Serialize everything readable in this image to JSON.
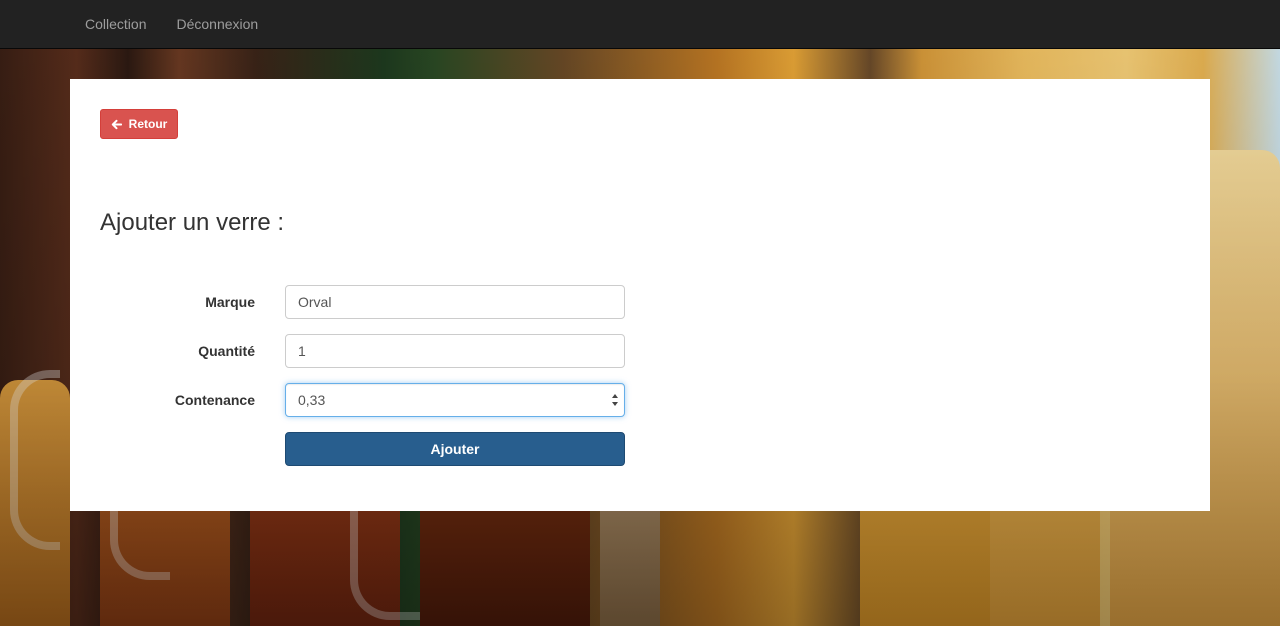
{
  "navbar": {
    "links": [
      "Collection",
      "Déconnexion"
    ]
  },
  "back_button": {
    "label": "Retour",
    "icon": "arrow-left-icon"
  },
  "page_title": "Ajouter un verre :",
  "form": {
    "marque": {
      "label": "Marque",
      "value": "Orval"
    },
    "quantite": {
      "label": "Quantité",
      "value": "1"
    },
    "contenance": {
      "label": "Contenance",
      "value": "0,33"
    },
    "submit_label": "Ajouter"
  },
  "colors": {
    "navbar_bg": "#222222",
    "danger": "#d9534f",
    "primary": "#285e8e"
  }
}
